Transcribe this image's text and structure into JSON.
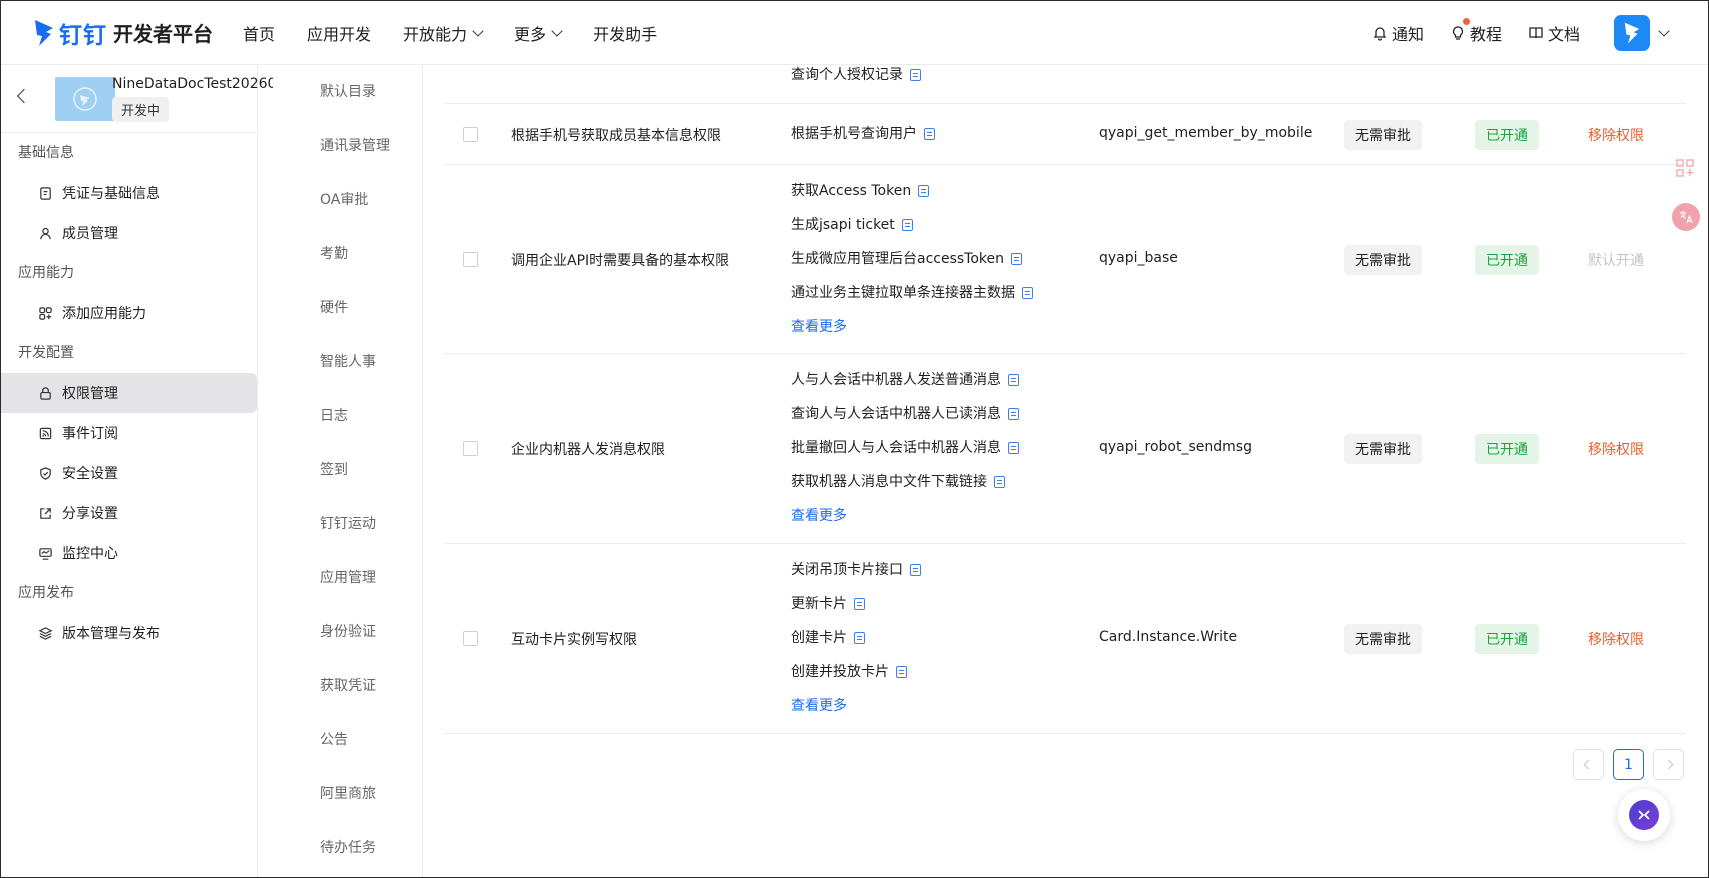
{
  "brand": {
    "name": "钉钉",
    "title": "开发者平台",
    "brand_color": "#1a6cf0"
  },
  "nav": {
    "items": [
      {
        "label": "首页",
        "dropdown": false
      },
      {
        "label": "应用开发",
        "dropdown": false
      },
      {
        "label": "开放能力",
        "dropdown": true
      },
      {
        "label": "更多",
        "dropdown": true
      },
      {
        "label": "开发助手",
        "dropdown": false
      }
    ],
    "notify": "通知",
    "tutorial": "教程",
    "docs": "文档"
  },
  "app": {
    "name": "NineDataDocTest20260",
    "status": "开发中"
  },
  "sidebar": {
    "groups": [
      {
        "title": "基础信息",
        "items": [
          {
            "label": "凭证与基础信息",
            "icon": "credential-icon"
          },
          {
            "label": "成员管理",
            "icon": "user-icon"
          }
        ]
      },
      {
        "title": "应用能力",
        "items": [
          {
            "label": "添加应用能力",
            "icon": "apps-icon"
          }
        ]
      },
      {
        "title": "开发配置",
        "items": [
          {
            "label": "权限管理",
            "icon": "lock-icon",
            "active": true
          },
          {
            "label": "事件订阅",
            "icon": "event-icon"
          },
          {
            "label": "安全设置",
            "icon": "shield-icon"
          },
          {
            "label": "分享设置",
            "icon": "share-icon"
          },
          {
            "label": "监控中心",
            "icon": "monitor-icon"
          }
        ]
      },
      {
        "title": "应用发布",
        "items": [
          {
            "label": "版本管理与发布",
            "icon": "layers-icon"
          }
        ]
      }
    ]
  },
  "categories": [
    "默认目录",
    "通讯录管理",
    "OA审批",
    "考勤",
    "硬件",
    "智能人事",
    "日志",
    "签到",
    "钉钉运动",
    "应用管理",
    "身份验证",
    "获取凭证",
    "公告",
    "阿里商旅",
    "待办任务"
  ],
  "table": {
    "partial_row": {
      "api": "查询个人授权记录"
    },
    "rows": [
      {
        "name": "根据手机号获取成员基本信息权限",
        "apis": [
          "根据手机号查询用户"
        ],
        "more": "",
        "code": "qyapi_get_member_by_mobile",
        "approval": "无需审批",
        "status": "已开通",
        "action": "移除权限",
        "action_disabled": false
      },
      {
        "name": "调用企业API时需要具备的基本权限",
        "apis": [
          "获取Access Token",
          "生成jsapi ticket",
          "生成微应用管理后台accessToken",
          "通过业务主键拉取单条连接器主数据"
        ],
        "more": "查看更多",
        "code": "qyapi_base",
        "approval": "无需审批",
        "status": "已开通",
        "action": "默认开通",
        "action_disabled": true
      },
      {
        "name": "企业内机器人发消息权限",
        "apis": [
          "人与人会话中机器人发送普通消息",
          "查询人与人会话中机器人已读消息",
          "批量撤回人与人会话中机器人消息",
          "获取机器人消息中文件下载链接"
        ],
        "more": "查看更多",
        "code": "qyapi_robot_sendmsg",
        "approval": "无需审批",
        "status": "已开通",
        "action": "移除权限",
        "action_disabled": false
      },
      {
        "name": "互动卡片实例写权限",
        "apis": [
          "关闭吊顶卡片接口",
          "更新卡片",
          "创建卡片",
          "创建并投放卡片"
        ],
        "more": "查看更多",
        "code": "Card.Instance.Write",
        "approval": "无需审批",
        "status": "已开通",
        "action": "移除权限",
        "action_disabled": false
      }
    ]
  },
  "pagination": {
    "current": "1"
  }
}
